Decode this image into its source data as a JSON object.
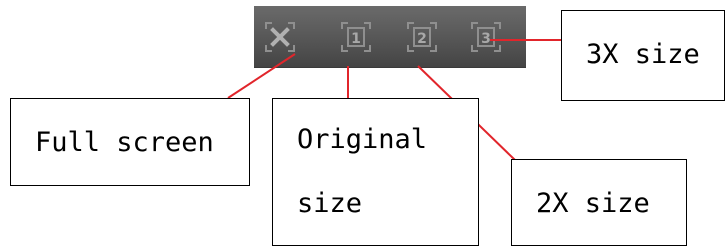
{
  "toolbar": {
    "buttons": [
      {
        "name": "full-screen-button",
        "icon": "fullscreen-x-icon",
        "glyph": "X"
      },
      {
        "name": "original-size-button",
        "icon": "zoom-1x-icon",
        "glyph": "1"
      },
      {
        "name": "2x-size-button",
        "icon": "zoom-2x-icon",
        "glyph": "2"
      },
      {
        "name": "3x-size-button",
        "icon": "zoom-3x-icon",
        "glyph": "3"
      }
    ]
  },
  "callouts": {
    "full_screen": "Full screen",
    "original_line1": "Original",
    "original_line2": "size",
    "size_2x": "2X size",
    "size_3x": "3X size"
  },
  "colors": {
    "connector": "#e1252b",
    "toolbar_bg": "#5a5a5a",
    "icon": "#9a9a9a"
  }
}
